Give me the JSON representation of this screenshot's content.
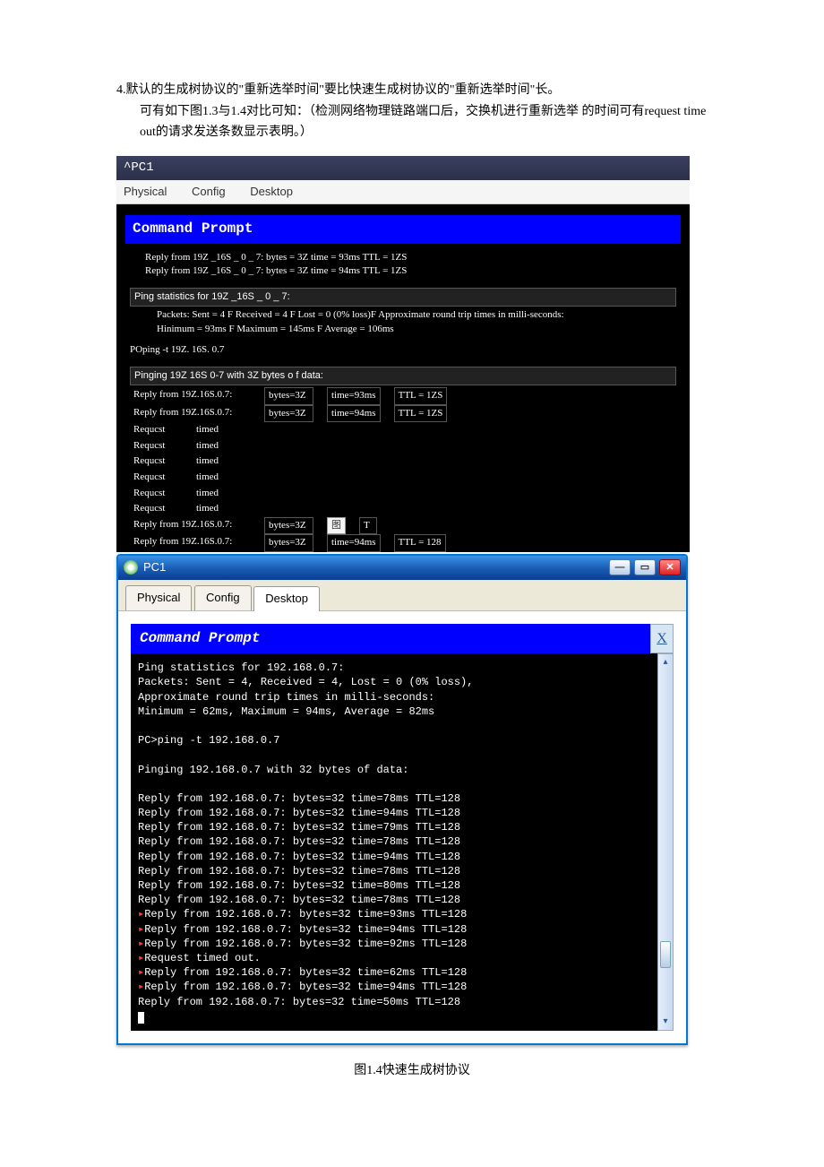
{
  "intro": {
    "line1": "4.默认的生成树协议的\"重新选举时间\"要比快速生成树协议的\"重新选举时间\"长。",
    "line2": "可有如下图1.3与1.4对比可知：（检测网络物理链路端口后，交换机进行重新选举 的时间可有request time out的请求发送条数显示表明。）"
  },
  "window1": {
    "title": "^PC1",
    "tabs": {
      "physical": "Physical",
      "config": "Config",
      "desktop": "Desktop"
    },
    "cmd_title": "Command Prompt",
    "l1": "Reply from 19Z _16S _ 0 _ 7: bytes = 3Z time = 93ms TTL = 1ZS",
    "l2": "Reply from 19Z _16S _ 0 _ 7: bytes = 3Z time = 94ms TTL = 1ZS",
    "stat_head": "Ping statistics for 19Z _16S _ 0 _ 7:",
    "stat_line": "Packets: Sent = 4 F Received = 4 F Lost = 0 (0% loss)F Approximate round trip times in milli-seconds:",
    "stat_line2": "Hinimum = 93ms F Maximum = 145ms F Average = 106ms",
    "cmd_ping": "POping -t 19Z. 16S. 0.7",
    "pinging": "Pinging 19Z   16S   0-7 with 3Z bytes o f data:",
    "rows": [
      {
        "a": "Reply from 19Z.16S.0.7:",
        "b": "bytes=3Z",
        "c": "time=93ms",
        "d": "TTL = 1ZS"
      },
      {
        "a": "Reply from 19Z.16S.0.7:",
        "b": "bytes=3Z",
        "c": "time=94ms",
        "d": "TTL = 1ZS"
      }
    ],
    "timeouts": [
      {
        "a": "Requcst",
        "b": "timed"
      },
      {
        "a": "Requcst",
        "b": "timed"
      },
      {
        "a": "Requcst",
        "b": "timed"
      },
      {
        "a": "Requcst",
        "b": "timed"
      },
      {
        "a": "Requcst",
        "b": "timed"
      },
      {
        "a": "Requcst",
        "b": "timed"
      }
    ],
    "footer": [
      {
        "a": "Reply from 19Z.16S.0.7:",
        "b": "bytes=3Z",
        "icon": "图",
        "d": "T"
      },
      {
        "a": "Reply from 19Z.16S.0.7:",
        "b": "bytes=3Z",
        "c": "time=94ms",
        "d": "TTL = 128"
      }
    ]
  },
  "window2": {
    "title": "PC1",
    "tabs": {
      "physical": "Physical",
      "config": "Config",
      "desktop": "Desktop"
    },
    "cmd_title": "Command Prompt",
    "close_x": "X",
    "lines": [
      "Ping statistics for 192.168.0.7:",
      "    Packets: Sent = 4, Received = 4, Lost = 0 (0% loss),",
      "Approximate round trip times in milli-seconds:",
      "    Minimum = 62ms, Maximum = 94ms, Average = 82ms",
      "",
      "PC>ping -t 192.168.0.7",
      "",
      "Pinging 192.168.0.7 with 32 bytes of data:",
      "",
      "Reply from 192.168.0.7: bytes=32 time=78ms TTL=128",
      "Reply from 192.168.0.7: bytes=32 time=94ms TTL=128",
      "Reply from 192.168.0.7: bytes=32 time=79ms TTL=128",
      "Reply from 192.168.0.7: bytes=32 time=78ms TTL=128",
      "Reply from 192.168.0.7: bytes=32 time=94ms TTL=128",
      "Reply from 192.168.0.7: bytes=32 time=78ms TTL=128",
      "Reply from 192.168.0.7: bytes=32 time=80ms TTL=128",
      "Reply from 192.168.0.7: bytes=32 time=78ms TTL=128"
    ],
    "red_lines": [
      "Reply from 192.168.0.7: bytes=32 time=93ms TTL=128",
      "Reply from 192.168.0.7: bytes=32 time=94ms TTL=128",
      "Reply from 192.168.0.7: bytes=32 time=92ms TTL=128",
      "Request timed out.",
      "Reply from 192.168.0.7: bytes=32 time=62ms TTL=128",
      "Reply from 192.168.0.7: bytes=32 time=94ms TTL=128"
    ],
    "after_red": "Reply from 192.168.0.7: bytes=32 time=50ms TTL=128"
  },
  "caption": "图1.4快速生成树协议"
}
